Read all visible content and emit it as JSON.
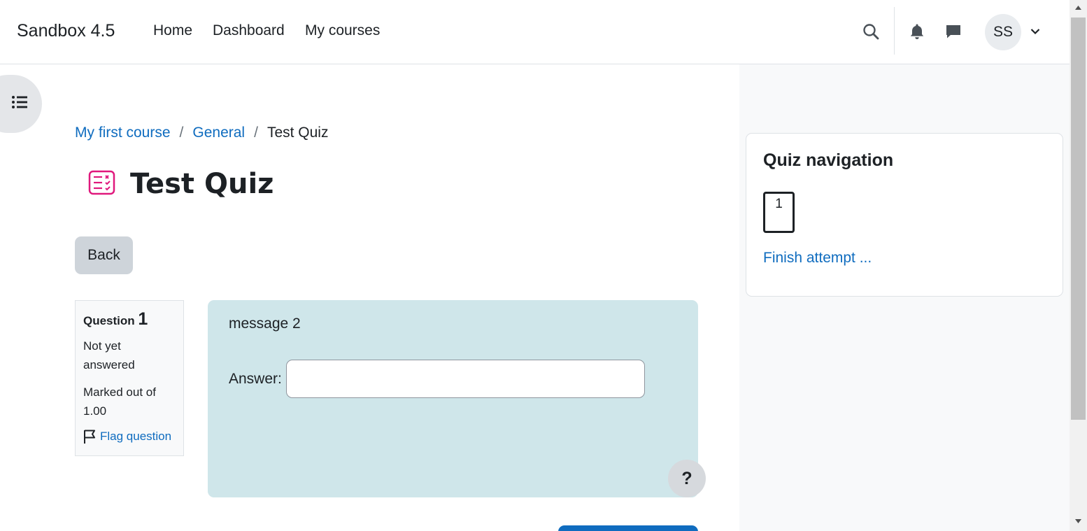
{
  "header": {
    "brand": "Sandbox 4.5",
    "nav": [
      "Home",
      "Dashboard",
      "My courses"
    ],
    "avatar_initials": "SS",
    "icons": [
      "search-icon",
      "bell-icon",
      "chat-icon",
      "chevron-down-icon"
    ]
  },
  "breadcrumb": {
    "items": [
      "My first course",
      "General",
      "Test Quiz"
    ],
    "separator": "/"
  },
  "page": {
    "title": "Test Quiz",
    "back_label": "Back"
  },
  "question": {
    "label": "Question",
    "number": "1",
    "state": "Not yet answered",
    "grade": "Marked out of 1.00",
    "flag_label": "Flag question",
    "text": "message 2",
    "answer_label": "Answer:",
    "answer_value": "",
    "help_label": "?"
  },
  "quiz_nav": {
    "title": "Quiz navigation",
    "buttons": [
      "1"
    ],
    "finish_label": "Finish attempt ..."
  },
  "colors": {
    "link": "#0f6cbf",
    "quiz_icon": "#e0197d",
    "question_bg": "#cfe6ea",
    "button_secondary": "#ced4da"
  }
}
